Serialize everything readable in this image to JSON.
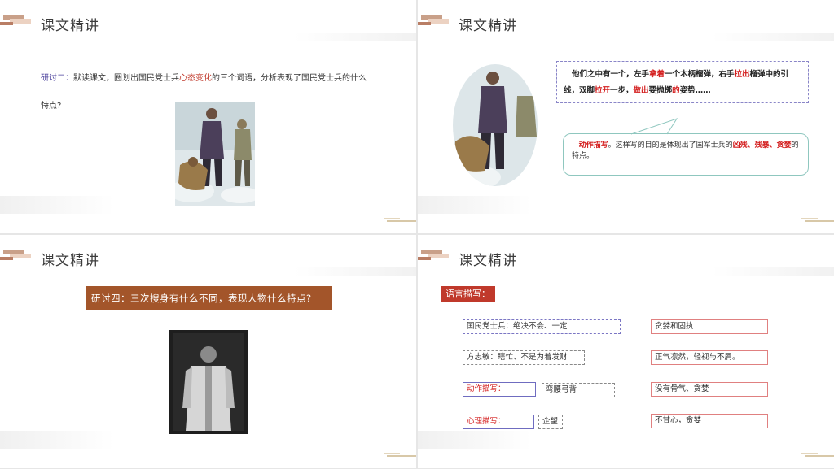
{
  "slide_title": "课文精讲",
  "slide1": {
    "question_label": "研讨二：",
    "question_part1": "默读课文，圈划出国民党士兵",
    "question_highlight": "心态变化",
    "question_part2": "的三个词语，分析表现了国民党士兵的什么",
    "question_line2": "特点?"
  },
  "slide2": {
    "quote": [
      {
        "text": "他们之中有一个，左手",
        "red": false
      },
      {
        "text": "拿着",
        "red": true
      },
      {
        "text": "一个木柄榴弹，右手",
        "red": false
      },
      {
        "text": "拉出",
        "red": true
      },
      {
        "text": "榴弹中的引线，双脚",
        "red": false
      },
      {
        "text": "拉开",
        "red": true
      },
      {
        "text": "一步，",
        "red": false
      },
      {
        "text": "做出",
        "red": true
      },
      {
        "text": "要抛掷",
        "red": false
      },
      {
        "text": "的",
        "red": true
      },
      {
        "text": "姿势……",
        "red": false
      }
    ],
    "note_label": "动作描写",
    "note_text1": "。这样写的目的是体现出了国军士兵的",
    "note_highlight": "凶残、残暴、贪婪",
    "note_text2": "的特点。"
  },
  "slide3": {
    "question": "研讨四：三次搜身有什么不同，表现人物什么特点?"
  },
  "slide4": {
    "tag": "语言描写：",
    "left_items": [
      "国民党士兵：绝决不会、一定",
      "方志敏：瞎忙、不是为着发财",
      "动作描写：",
      "心理描写："
    ],
    "middle_items": [
      "弯腰弓背",
      "企望"
    ],
    "right_items": [
      "贪婪和固执",
      "正气凛然，轻视与不屑。",
      "没有骨气、贪婪",
      "不甘心，贪婪"
    ]
  },
  "colors": {
    "accent_brown": "#a3552a",
    "highlight_red": "#d42020",
    "label_purple": "#4a3f9b"
  }
}
